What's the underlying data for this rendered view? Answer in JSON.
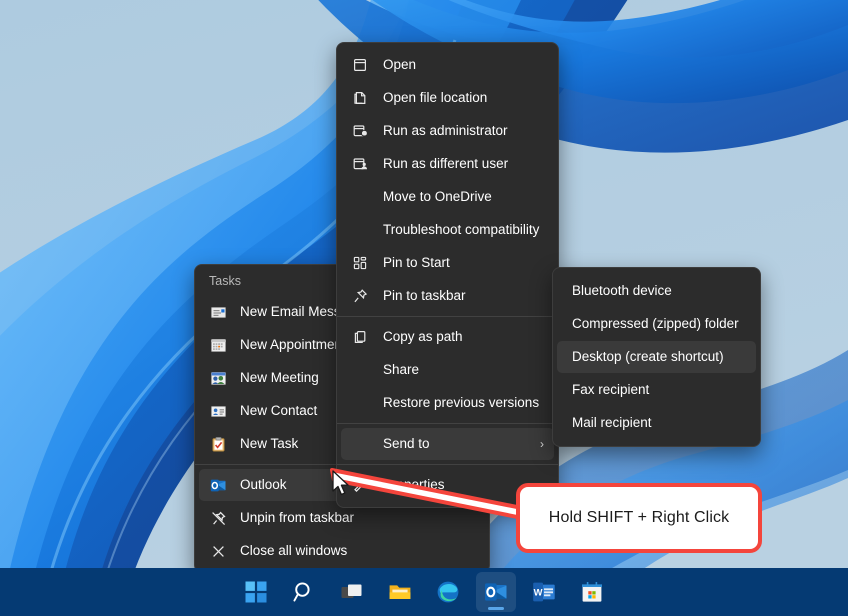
{
  "desktop": {
    "wallpaper_name": "windows-11-bloom-wallpaper",
    "background_color": "#9cbdd8"
  },
  "jumplist": {
    "name": "outlook-taskbar-jumplist",
    "group_title": "Tasks",
    "tasks": [
      {
        "label": "New Email Message",
        "icon": "new-email-icon"
      },
      {
        "label": "New Appointment",
        "icon": "calendar-icon"
      },
      {
        "label": "New Meeting",
        "icon": "meeting-people-icon"
      },
      {
        "label": "New Contact",
        "icon": "contact-card-icon"
      },
      {
        "label": "New Task",
        "icon": "task-clipboard-icon"
      }
    ],
    "app": {
      "label": "Outlook",
      "icon": "outlook-icon",
      "highlighted": true
    },
    "actions": [
      {
        "label": "Unpin from taskbar",
        "icon": "unpin-icon"
      },
      {
        "label": "Close all windows",
        "icon": "close-icon"
      }
    ]
  },
  "context_menu": {
    "name": "shift-right-click-context-menu",
    "groups": [
      [
        {
          "label": "Open",
          "icon": "open-window-icon"
        },
        {
          "label": "Open file location",
          "icon": "folder-page-icon"
        },
        {
          "label": "Run as administrator",
          "icon": "shield-admin-icon"
        },
        {
          "label": "Run as different user",
          "icon": "user-switch-icon"
        },
        {
          "label": "Move to OneDrive",
          "icon": "none"
        },
        {
          "label": "Troubleshoot compatibility",
          "icon": "none"
        },
        {
          "label": "Pin to Start",
          "icon": "pin-to-start-icon"
        },
        {
          "label": "Pin to taskbar",
          "icon": "pin-icon"
        }
      ],
      [
        {
          "label": "Copy as path",
          "icon": "copy-icon"
        },
        {
          "label": "Share",
          "icon": "none"
        },
        {
          "label": "Restore previous versions",
          "icon": "none"
        }
      ],
      [
        {
          "label": "Send to",
          "icon": "none",
          "has_submenu": true,
          "highlighted": true,
          "chevron": "›"
        }
      ],
      [
        {
          "label": "Properties",
          "icon": "wrench-icon"
        }
      ]
    ]
  },
  "submenu": {
    "name": "send-to-submenu",
    "items": [
      {
        "label": "Bluetooth device",
        "highlighted": false
      },
      {
        "label": "Compressed (zipped) folder",
        "highlighted": false
      },
      {
        "label": "Desktop (create shortcut)",
        "highlighted": true
      },
      {
        "label": "Fax recipient",
        "highlighted": false
      },
      {
        "label": "Mail recipient",
        "highlighted": false
      }
    ]
  },
  "callout": {
    "text": "Hold SHIFT + Right Click",
    "border_color": "#f4453c",
    "background_color": "#ffffff",
    "text_color": "#1b1b1b"
  },
  "taskbar": {
    "background_color": "#053a73",
    "items": [
      {
        "name": "start-button",
        "icon": "windows-start-icon",
        "active": false
      },
      {
        "name": "search-button",
        "icon": "search-icon",
        "active": false
      },
      {
        "name": "task-view-button",
        "icon": "task-view-icon",
        "active": false
      },
      {
        "name": "file-explorer-button",
        "icon": "file-explorer-icon",
        "active": false
      },
      {
        "name": "edge-button",
        "icon": "edge-icon",
        "active": false
      },
      {
        "name": "outlook-button",
        "icon": "outlook-icon",
        "active": true
      },
      {
        "name": "word-button",
        "icon": "word-icon",
        "active": false
      },
      {
        "name": "microsoft-store-button",
        "icon": "store-icon",
        "active": false
      }
    ]
  }
}
